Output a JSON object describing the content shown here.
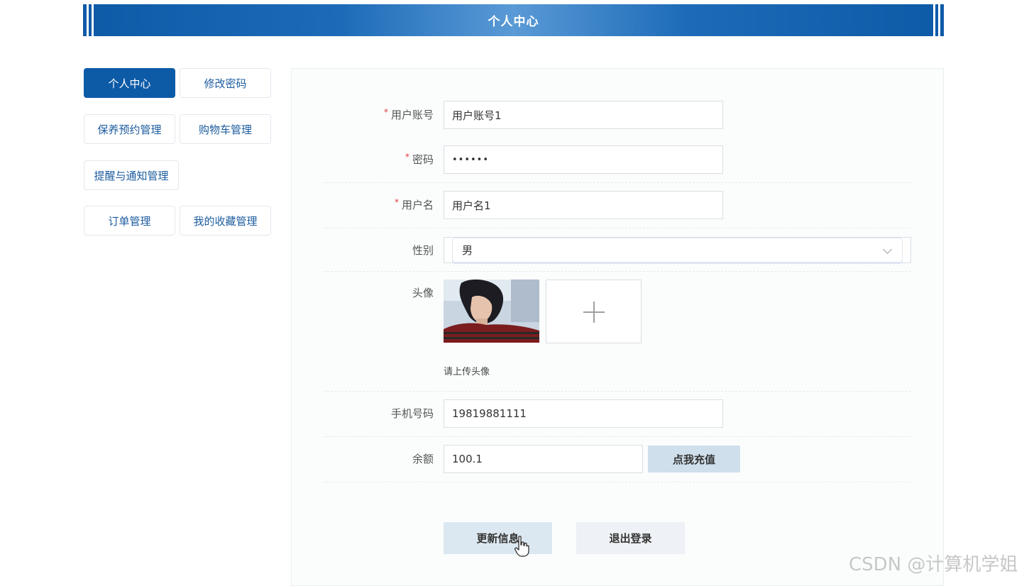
{
  "header": {
    "title": "个人中心"
  },
  "sidebar": {
    "items": [
      {
        "label": "个人中心",
        "active": true
      },
      {
        "label": "修改密码",
        "active": false
      },
      {
        "label": "保养预约管理",
        "active": false
      },
      {
        "label": "购物车管理",
        "active": false
      },
      {
        "label": "提醒与通知管理",
        "active": false
      },
      {
        "label": "订单管理",
        "active": false
      },
      {
        "label": "我的收藏管理",
        "active": false
      }
    ]
  },
  "form": {
    "account": {
      "label": "用户账号",
      "value": "用户账号1",
      "required_mark": "*"
    },
    "password": {
      "label": "密码",
      "value": "••••••",
      "required_mark": "*"
    },
    "username": {
      "label": "用户名",
      "value": "用户名1",
      "required_mark": "*"
    },
    "gender": {
      "label": "性别",
      "value": "男"
    },
    "avatar": {
      "label": "头像",
      "hint": "请上传头像"
    },
    "phone": {
      "label": "手机号码",
      "value": "19819881111"
    },
    "balance": {
      "label": "余额",
      "value": "100.1",
      "recharge_label": "点我充值"
    }
  },
  "actions": {
    "update_label": "更新信息",
    "logout_label": "退出登录"
  },
  "watermark": "CSDN @计算机学姐",
  "colors": {
    "primary": "#0d5aa7",
    "required": "#e0393b"
  }
}
